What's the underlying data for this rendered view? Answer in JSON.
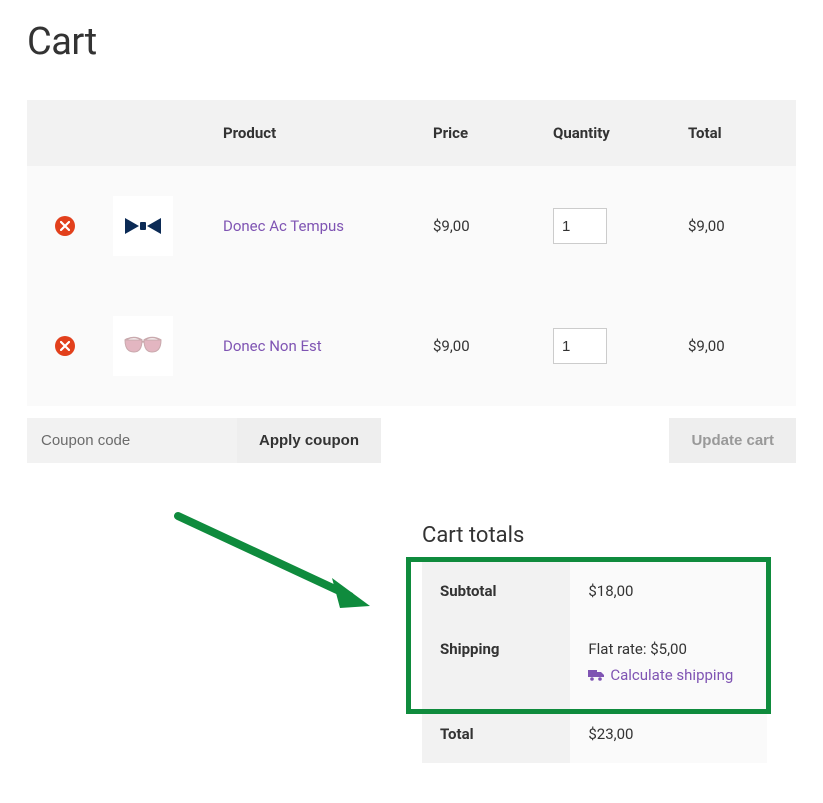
{
  "page_title": "Cart",
  "columns": {
    "product": "Product",
    "price": "Price",
    "quantity": "Quantity",
    "total": "Total"
  },
  "items": [
    {
      "name": "Donec Ac Tempus",
      "price": "$9,00",
      "qty": "1",
      "line_total": "$9,00",
      "icon": "bowtie"
    },
    {
      "name": "Donec Non Est",
      "price": "$9,00",
      "qty": "1",
      "line_total": "$9,00",
      "icon": "sunglasses"
    }
  ],
  "coupon": {
    "placeholder": "Coupon code",
    "apply_label": "Apply coupon"
  },
  "update_cart_label": "Update cart",
  "totals": {
    "heading": "Cart totals",
    "subtotal_label": "Subtotal",
    "subtotal_value": "$18,00",
    "shipping_label": "Shipping",
    "shipping_text": "Flat rate: $5,00",
    "calc_label": "Calculate shipping",
    "total_label": "Total",
    "total_value": "$23,00"
  }
}
